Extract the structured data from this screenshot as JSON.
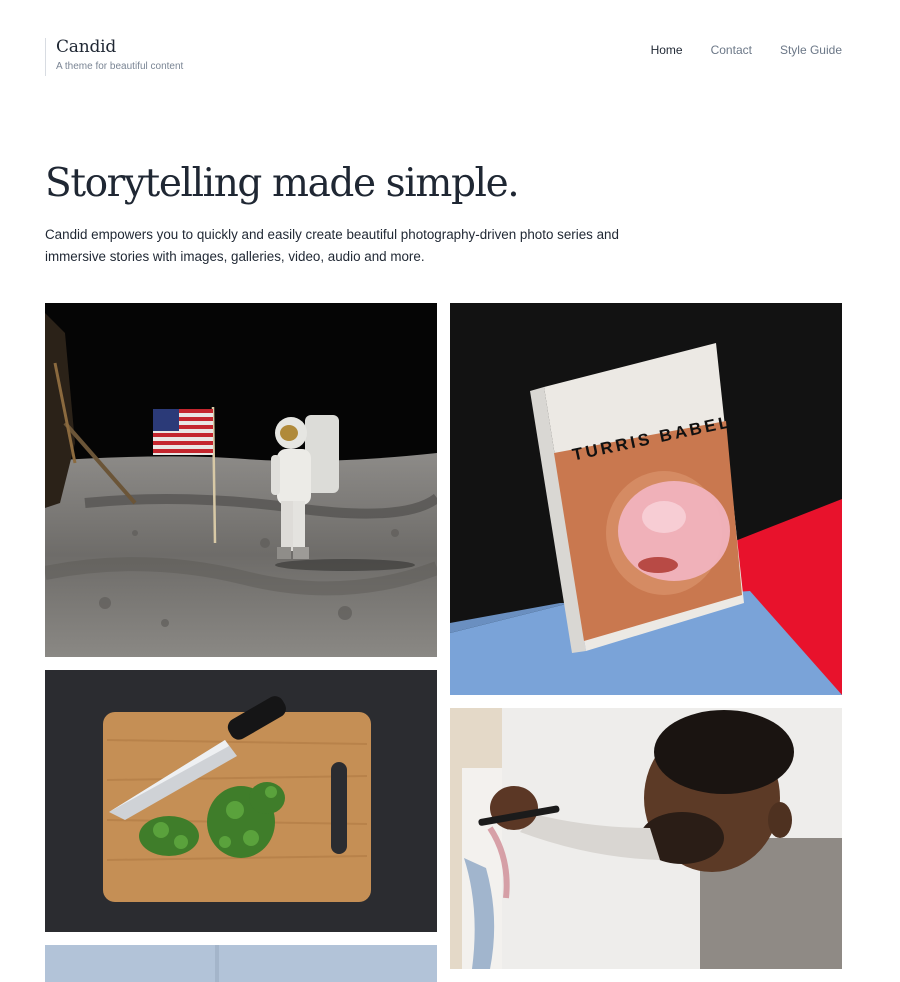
{
  "site": {
    "title": "Candid",
    "tagline": "A theme for beautiful content"
  },
  "nav": {
    "items": [
      {
        "label": "Home",
        "active": true
      },
      {
        "label": "Contact",
        "active": false
      },
      {
        "label": "Style Guide",
        "active": false
      }
    ]
  },
  "hero": {
    "heading": "Storytelling made simple.",
    "intro": "Candid empowers you to quickly and easily create beautiful photography-driven photo series and immersive stories with images, galleries, video, audio and more."
  },
  "gallery": {
    "book_cover_title": "TURRIS  BABEL"
  },
  "colors": {
    "text": "#1f2733",
    "muted": "#7a8594",
    "nav_link": "#6b7787"
  }
}
